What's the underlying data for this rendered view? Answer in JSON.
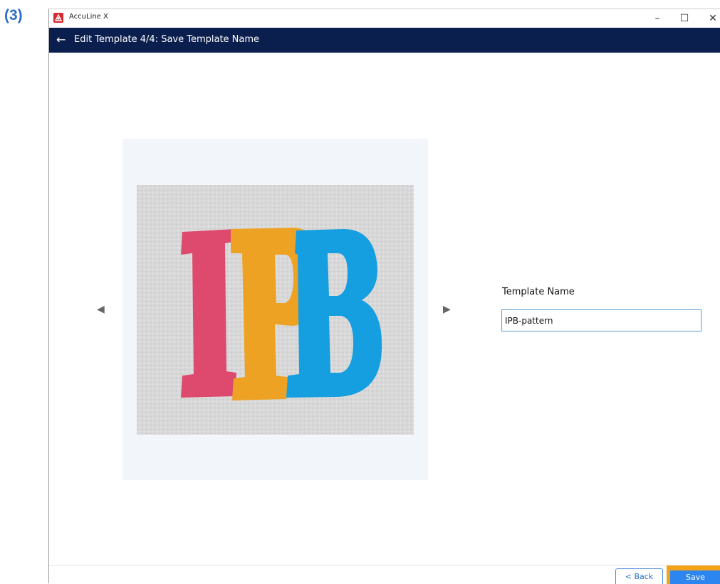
{
  "figure_label": "(3)",
  "window": {
    "app_title": "AccuLine X",
    "controls": {
      "minimize": "–",
      "maximize": "☐",
      "close": "✕"
    }
  },
  "header": {
    "back_icon": "←",
    "title": "Edit Template 4/4: Save Template Name"
  },
  "preview": {
    "image_text": "IPB",
    "letter_colors": [
      "#de4a6e",
      "#eea224",
      "#159fe0"
    ],
    "prev_icon": "◀",
    "next_icon": "▶"
  },
  "form": {
    "label": "Template Name",
    "value": "IPB-pattern"
  },
  "footer": {
    "back_label": "< Back",
    "save_label": "Save"
  },
  "colors": {
    "header_bg": "#0b1f4f",
    "save_bg": "#2d86f0",
    "save_highlight": "#f2a31a"
  }
}
